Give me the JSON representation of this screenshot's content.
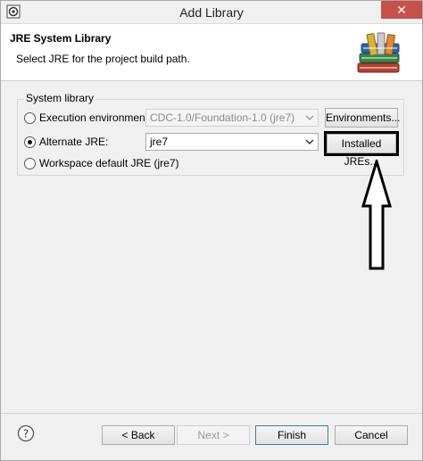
{
  "window": {
    "title": "Add Library",
    "close_glyph": "✕"
  },
  "header": {
    "title": "JRE System Library",
    "description": "Select JRE for the project build path.",
    "icon": "books-icon"
  },
  "group": {
    "label": "System library",
    "options": [
      {
        "label": "Execution environment:",
        "checked": false,
        "select_value": "CDC-1.0/Foundation-1.0 (jre7)",
        "select_disabled": true,
        "button_label": "Environments..."
      },
      {
        "label": "Alternate JRE:",
        "checked": true,
        "select_value": "jre7",
        "select_disabled": false,
        "button_label": "Installed JREs..."
      },
      {
        "label": "Workspace default JRE (jre7)",
        "checked": false
      }
    ]
  },
  "footer": {
    "help_glyph": "?",
    "back_label": "< Back",
    "next_label": "Next >",
    "finish_label": "Finish",
    "cancel_label": "Cancel"
  },
  "colors": {
    "close": "#c7504a",
    "accent_border": "#3c7fb1",
    "highlight": "#000000"
  }
}
